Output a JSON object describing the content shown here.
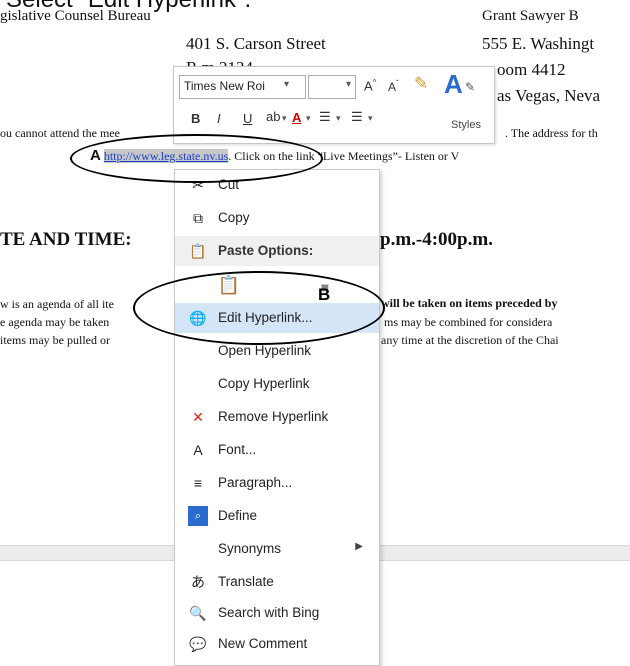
{
  "caption": "Select \"Edit Hyperlink\".",
  "document": {
    "line1_left": "gislative Counsel Bureau",
    "line1_right": "Grant Sawyer B",
    "line2_left": "401 S. Carson Street",
    "line2_right": "555 E. Washingt",
    "line3_left": "R    m 2134",
    "line3_right": "oom 4412",
    "line4_right": "as Vegas, Neva",
    "para1_left": "ou cannot attend the mee",
    "para1_right": ". The address for th",
    "link_text": "http://www.leg.state.nv.us",
    "para2_after": ". Click on the link “Live Meetings”- Listen or V",
    "heading_left": "TE AND TIME:",
    "heading_right": "p.m.-4:00p.m.",
    "agenda1_left": "w is an agenda of all ite",
    "agenda1_right": "will be taken on items preceded by",
    "agenda2_left": "e agenda may be taken",
    "agenda2_right": "ms may be combined for considera",
    "agenda3_left": "items may be pulled or",
    "agenda3_right": "any time at the discretion of the Chai"
  },
  "mini_toolbar": {
    "font_name": "Times New Roi",
    "font_size": "",
    "styles_label": "Styles"
  },
  "context_menu": {
    "items": [
      {
        "label": "Cut",
        "icon": "scissors-icon"
      },
      {
        "label": "Copy",
        "icon": "copy-icon"
      },
      {
        "label": "Paste Options:",
        "icon": "paste-icon"
      },
      {
        "label": "",
        "icon": "paste-keep-text-icon"
      },
      {
        "label": "Edit Hyperlink...",
        "icon": "globe-link-icon"
      },
      {
        "label": "Open Hyperlink",
        "icon": ""
      },
      {
        "label": "Copy Hyperlink",
        "icon": ""
      },
      {
        "label": "Remove Hyperlink",
        "icon": "remove-link-icon"
      },
      {
        "label": "Font...",
        "icon": "font-icon"
      },
      {
        "label": "Paragraph...",
        "icon": "paragraph-icon"
      },
      {
        "label": "Define",
        "icon": "define-icon"
      },
      {
        "label": "Synonyms",
        "icon": ""
      },
      {
        "label": "Translate",
        "icon": "translate-icon"
      },
      {
        "label": "Search with Bing",
        "icon": "search-icon"
      },
      {
        "label": "New Comment",
        "icon": "comment-icon"
      }
    ],
    "highlighted": "Edit Hyperlink..."
  },
  "annotations": {
    "marker_a": "A",
    "marker_b": "B"
  }
}
